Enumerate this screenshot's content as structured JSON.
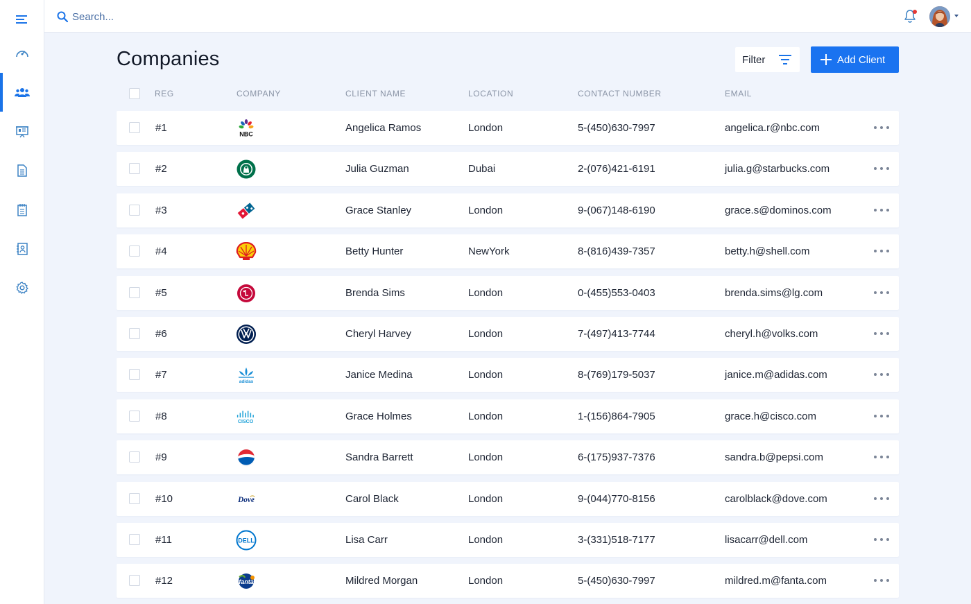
{
  "sidebar": {
    "items": [
      {
        "icon": "menu-icon"
      },
      {
        "icon": "dashboard-gauge-icon"
      },
      {
        "icon": "users-group-icon",
        "active": true
      },
      {
        "icon": "presentation-icon"
      },
      {
        "icon": "document-icon"
      },
      {
        "icon": "notepad-icon"
      },
      {
        "icon": "contacts-book-icon"
      },
      {
        "icon": "gear-icon"
      }
    ]
  },
  "header": {
    "search_placeholder": "Search...",
    "notification_icon": "bell-icon",
    "accent_color": "#1a73f0",
    "alert_color": "#e53935"
  },
  "main": {
    "title": "Companies",
    "filter_label": "Filter",
    "add_label": "Add Client"
  },
  "table": {
    "columns": {
      "reg": "REG",
      "company": "COMPANY",
      "client_name": "CLIENT NAME",
      "location": "LOCATION",
      "contact": "CONTACT NUMBER",
      "email": "EMAIL"
    },
    "rows": [
      {
        "reg": "#1",
        "logo": "nbc-logo",
        "name": "Angelica Ramos",
        "location": "London",
        "phone": "5-(450)630-7997",
        "email": "angelica.r@nbc.com"
      },
      {
        "reg": "#2",
        "logo": "starbucks-logo",
        "name": "Julia Guzman",
        "location": "Dubai",
        "phone": "2-(076)421-6191",
        "email": "julia.g@starbucks.com"
      },
      {
        "reg": "#3",
        "logo": "dominos-logo",
        "name": "Grace Stanley",
        "location": "London",
        "phone": "9-(067)148-6190",
        "email": "grace.s@dominos.com"
      },
      {
        "reg": "#4",
        "logo": "shell-logo",
        "name": "Betty Hunter",
        "location": "NewYork",
        "phone": "8-(816)439-7357",
        "email": "betty.h@shell.com"
      },
      {
        "reg": "#5",
        "logo": "lg-logo",
        "name": "Brenda Sims",
        "location": "London",
        "phone": "0-(455)553-0403",
        "email": "brenda.sims@lg.com"
      },
      {
        "reg": "#6",
        "logo": "volkswagen-logo",
        "name": "Cheryl Harvey",
        "location": "London",
        "phone": "7-(497)413-7744",
        "email": "cheryl.h@volks.com"
      },
      {
        "reg": "#7",
        "logo": "adidas-logo",
        "name": "Janice Medina",
        "location": "London",
        "phone": "8-(769)179-5037",
        "email": "janice.m@adidas.com"
      },
      {
        "reg": "#8",
        "logo": "cisco-logo",
        "name": "Grace Holmes",
        "location": "London",
        "phone": "1-(156)864-7905",
        "email": "grace.h@cisco.com"
      },
      {
        "reg": "#9",
        "logo": "pepsi-logo",
        "name": "Sandra Barrett",
        "location": "London",
        "phone": "6-(175)937-7376",
        "email": "sandra.b@pepsi.com"
      },
      {
        "reg": "#10",
        "logo": "dove-logo",
        "name": "Carol Black",
        "location": "London",
        "phone": "9-(044)770-8156",
        "email": "carolblack@dove.com"
      },
      {
        "reg": "#11",
        "logo": "dell-logo",
        "name": "Lisa Carr",
        "location": "London",
        "phone": "3-(331)518-7177",
        "email": "lisacarr@dell.com"
      },
      {
        "reg": "#12",
        "logo": "fanta-logo",
        "name": "Mildred Morgan",
        "location": "London",
        "phone": "5-(450)630-7997",
        "email": "mildred.m@fanta.com"
      }
    ]
  }
}
